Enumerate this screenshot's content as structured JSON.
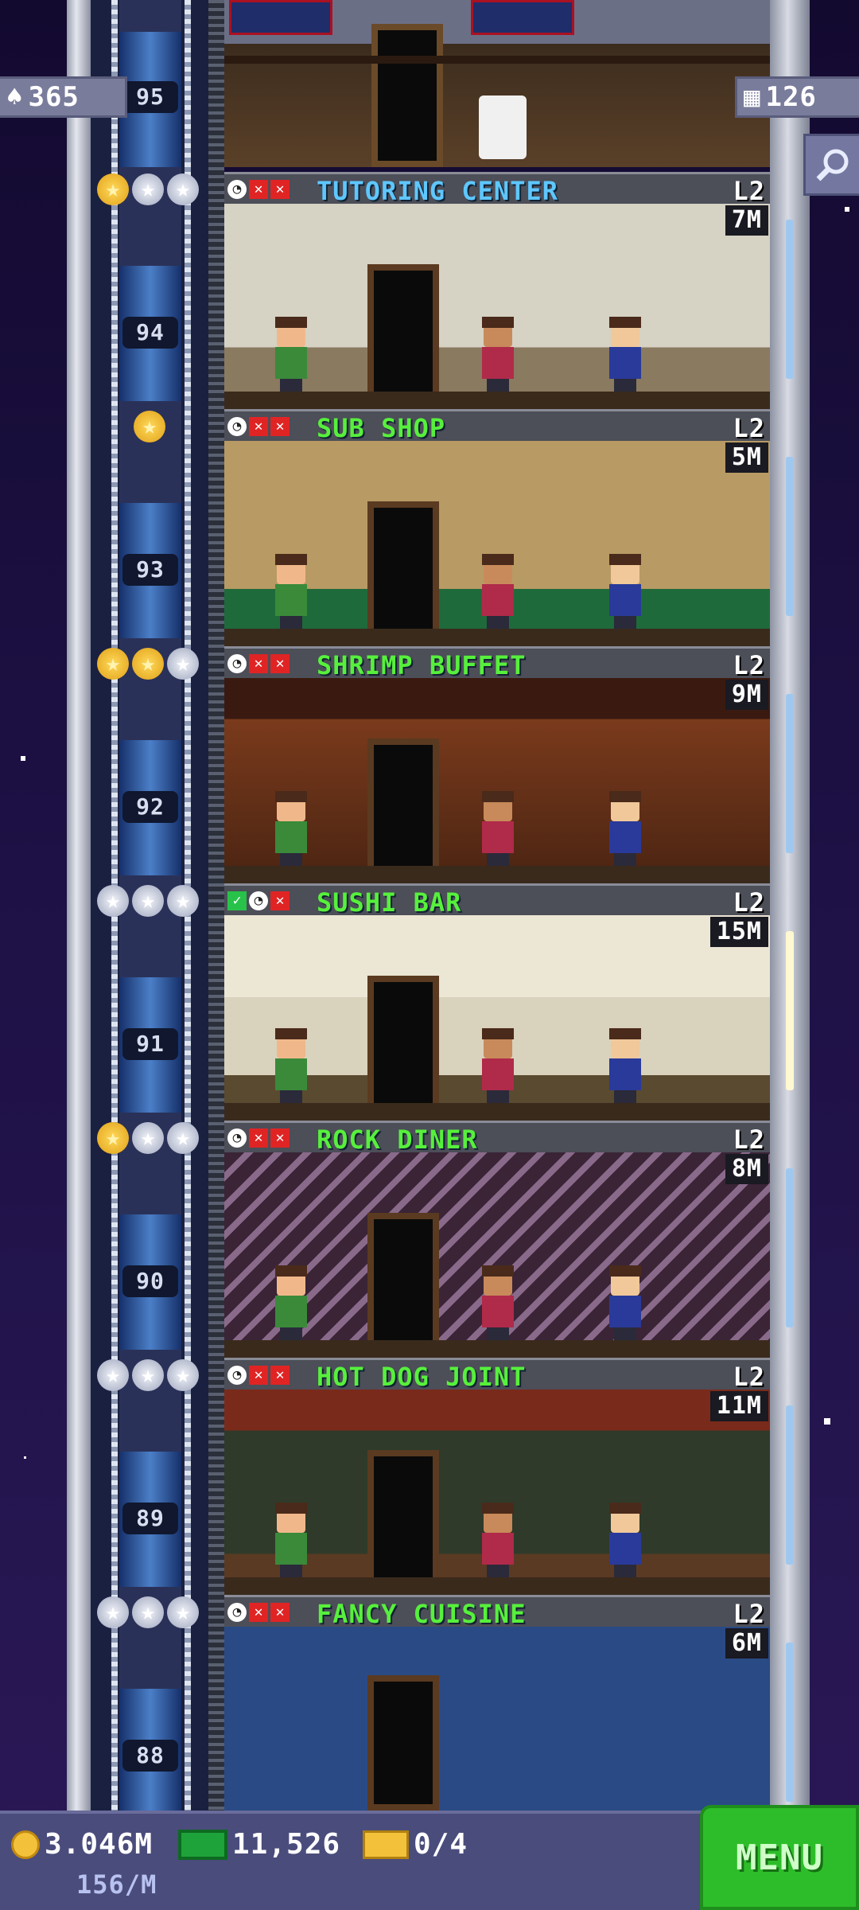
{
  "top_left_badge": {
    "icon": "person-icon",
    "value": "365"
  },
  "top_right_badge": {
    "icon": "building-icon",
    "value": "126"
  },
  "top_floor_number": "95",
  "floors": [
    {
      "number": "94",
      "name": "TUTORING CENTER",
      "name_color": "#5ec7ff",
      "level": "L2",
      "price": "7M",
      "stars": [
        "gold",
        "silver",
        "silver"
      ],
      "status": [
        "clock",
        "x",
        "x"
      ]
    },
    {
      "number": "93",
      "name": "SUB SHOP",
      "name_color": "#57f03c",
      "level": "L2",
      "price": "5M",
      "stars": [
        "gold"
      ],
      "status": [
        "clock",
        "x",
        "x"
      ]
    },
    {
      "number": "92",
      "name": "SHRIMP BUFFET",
      "name_color": "#57f03c",
      "level": "L2",
      "price": "9M",
      "stars": [
        "gold",
        "gold",
        "silver"
      ],
      "status": [
        "clock",
        "x",
        "x"
      ]
    },
    {
      "number": "91",
      "name": "SUSHI BAR",
      "name_color": "#57f03c",
      "level": "L2",
      "price": "15M",
      "stars": [
        "silver",
        "silver",
        "silver"
      ],
      "status": [
        "check",
        "clock",
        "x"
      ]
    },
    {
      "number": "90",
      "name": "ROCK DINER",
      "name_color": "#57f03c",
      "level": "L2",
      "price": "8M",
      "stars": [
        "gold",
        "silver",
        "silver"
      ],
      "status": [
        "clock",
        "x",
        "x"
      ]
    },
    {
      "number": "89",
      "name": "HOT DOG JOINT",
      "name_color": "#57f03c",
      "level": "L2",
      "price": "11M",
      "stars": [
        "silver",
        "silver",
        "silver"
      ],
      "status": [
        "clock",
        "x",
        "x"
      ]
    },
    {
      "number": "88",
      "name": "FANCY CUISINE",
      "name_color": "#57f03c",
      "level": "L2",
      "price": "6M",
      "stars": [
        "silver",
        "silver",
        "silver"
      ],
      "status": [
        "clock",
        "x",
        "x"
      ]
    }
  ],
  "bottom_bar": {
    "coins": "3.046M",
    "coin_rate": "156/M",
    "bux": "11,526",
    "tickets": "0/4",
    "menu_label": "MENU"
  }
}
